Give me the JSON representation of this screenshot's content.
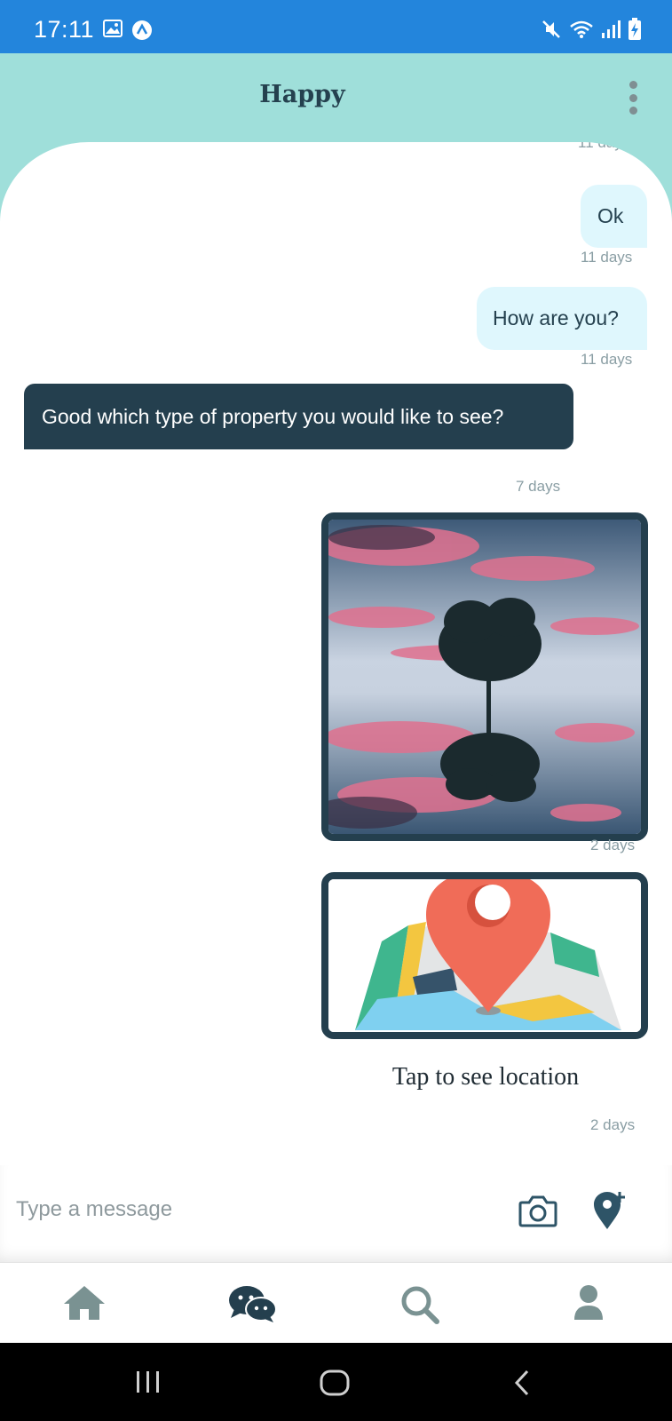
{
  "status_bar": {
    "time": "17:11"
  },
  "header": {
    "title": "Happy"
  },
  "messages": [
    {
      "direction": "outgoing",
      "text": "Ok",
      "time": "11 days"
    },
    {
      "direction": "outgoing",
      "text": "How are you?",
      "time": "11 days"
    },
    {
      "direction": "incoming",
      "text": "Good which type of property you would like to see?",
      "time": "7 days"
    },
    {
      "direction": "outgoing",
      "type": "image",
      "time": "2 days"
    },
    {
      "direction": "outgoing",
      "type": "location",
      "caption": "Tap to see location",
      "time": "2 days"
    }
  ],
  "partial_top_time": "11 days",
  "composer": {
    "placeholder": "Type a message"
  },
  "colors": {
    "status_bar": "#2385dc",
    "header": "#9fdfda",
    "accent_dark": "#243f4e",
    "bubble_out": "#dff7fd",
    "icon_muted": "#7f9797"
  },
  "bottom_nav": [
    "home-icon",
    "chat-icon",
    "search-icon",
    "profile-icon"
  ]
}
